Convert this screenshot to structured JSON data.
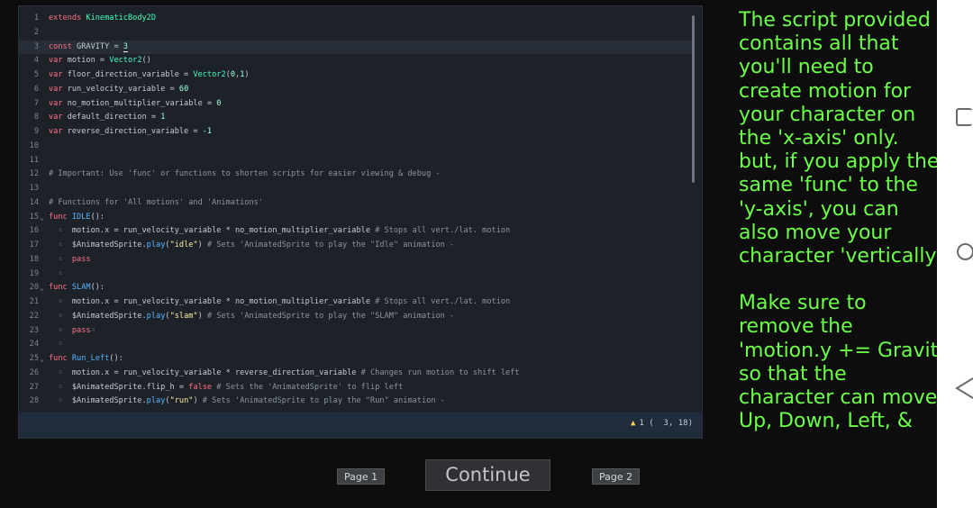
{
  "editor": {
    "cut_top_fragment": "",
    "lines": [
      {
        "num": "1",
        "fold": "",
        "segs": [
          {
            "t": "extends ",
            "c": "kw"
          },
          {
            "t": "KinematicBody2D",
            "c": "ty"
          }
        ]
      },
      {
        "num": "2",
        "fold": "",
        "segs": []
      },
      {
        "num": "3",
        "fold": "",
        "current": true,
        "segs": [
          {
            "t": "const ",
            "c": "kw"
          },
          {
            "t": "GRAVITY = ",
            "c": ""
          },
          {
            "t": "3",
            "c": "num cursor"
          }
        ]
      },
      {
        "num": "4",
        "fold": "",
        "segs": [
          {
            "t": "var ",
            "c": "kw"
          },
          {
            "t": "motion = ",
            "c": ""
          },
          {
            "t": "Vector2",
            "c": "ty"
          },
          {
            "t": "()",
            "c": ""
          }
        ]
      },
      {
        "num": "5",
        "fold": "",
        "segs": [
          {
            "t": "var ",
            "c": "kw"
          },
          {
            "t": "floor_direction_variable = ",
            "c": ""
          },
          {
            "t": "Vector2",
            "c": "ty"
          },
          {
            "t": "(",
            "c": ""
          },
          {
            "t": "0",
            "c": "num"
          },
          {
            "t": ",",
            "c": ""
          },
          {
            "t": "1",
            "c": "num"
          },
          {
            "t": ")",
            "c": ""
          }
        ]
      },
      {
        "num": "6",
        "fold": "",
        "segs": [
          {
            "t": "var ",
            "c": "kw"
          },
          {
            "t": "run_velocity_variable = ",
            "c": ""
          },
          {
            "t": "60",
            "c": "num"
          }
        ]
      },
      {
        "num": "7",
        "fold": "",
        "segs": [
          {
            "t": "var ",
            "c": "kw"
          },
          {
            "t": "no_motion_multiplier_variable = ",
            "c": ""
          },
          {
            "t": "0",
            "c": "num"
          }
        ]
      },
      {
        "num": "8",
        "fold": "",
        "segs": [
          {
            "t": "var ",
            "c": "kw"
          },
          {
            "t": "default_direction = ",
            "c": ""
          },
          {
            "t": "1",
            "c": "num"
          }
        ]
      },
      {
        "num": "9",
        "fold": "",
        "segs": [
          {
            "t": "var ",
            "c": "kw"
          },
          {
            "t": "reverse_direction_variable = ",
            "c": ""
          },
          {
            "t": "-1",
            "c": "num"
          }
        ]
      },
      {
        "num": "10",
        "fold": "",
        "segs": []
      },
      {
        "num": "11",
        "fold": "",
        "segs": []
      },
      {
        "num": "12",
        "fold": "",
        "segs": [
          {
            "t": "# Important: Use 'func' or functions to shorten scripts for easier viewing & debug -",
            "c": "cmt"
          }
        ]
      },
      {
        "num": "13",
        "fold": "",
        "segs": []
      },
      {
        "num": "14",
        "fold": "",
        "segs": [
          {
            "t": "# Functions for 'All motions' and 'Animations'",
            "c": "cmt"
          }
        ]
      },
      {
        "num": "15",
        "fold": "v",
        "segs": [
          {
            "t": "func ",
            "c": "kw"
          },
          {
            "t": "IDLE",
            "c": "fnc"
          },
          {
            "t": "():",
            "c": ""
          }
        ]
      },
      {
        "num": "16",
        "fold": "",
        "segs": [
          {
            "t": "  ¤  ",
            "c": "guide"
          },
          {
            "t": "motion.x = run_velocity_variable * no_motion_multiplier_variable ",
            "c": ""
          },
          {
            "t": "# Stops all vert./lat. motion",
            "c": "cmt"
          }
        ]
      },
      {
        "num": "17",
        "fold": "",
        "segs": [
          {
            "t": "  ¤  ",
            "c": "guide"
          },
          {
            "t": "$AnimatedSprite.",
            "c": ""
          },
          {
            "t": "play",
            "c": "fnc"
          },
          {
            "t": "(",
            "c": ""
          },
          {
            "t": "\"idle\"",
            "c": "str"
          },
          {
            "t": ") ",
            "c": ""
          },
          {
            "t": "# Sets 'AnimatedSprite to play the \"Idle\" animation -",
            "c": "cmt"
          }
        ]
      },
      {
        "num": "18",
        "fold": "",
        "segs": [
          {
            "t": "  ¤  ",
            "c": "guide"
          },
          {
            "t": "pass",
            "c": "kw"
          }
        ]
      },
      {
        "num": "19",
        "fold": "",
        "segs": [
          {
            "t": "  ¤",
            "c": "guide"
          }
        ]
      },
      {
        "num": "20",
        "fold": "v",
        "segs": [
          {
            "t": "func ",
            "c": "kw"
          },
          {
            "t": "SLAM",
            "c": "fnc"
          },
          {
            "t": "():",
            "c": ""
          }
        ]
      },
      {
        "num": "21",
        "fold": "",
        "segs": [
          {
            "t": "  ¤  ",
            "c": "guide"
          },
          {
            "t": "motion.x = run_velocity_variable * no_motion_multiplier_variable ",
            "c": ""
          },
          {
            "t": "# Stops all vert./lat. motion",
            "c": "cmt"
          }
        ]
      },
      {
        "num": "22",
        "fold": "",
        "segs": [
          {
            "t": "  ¤  ",
            "c": "guide"
          },
          {
            "t": "$AnimatedSprite.",
            "c": ""
          },
          {
            "t": "play",
            "c": "fnc"
          },
          {
            "t": "(",
            "c": ""
          },
          {
            "t": "\"slam\"",
            "c": "str"
          },
          {
            "t": ") ",
            "c": ""
          },
          {
            "t": "# Sets 'AnimatedSprite to play the \"SLAM\" animation -",
            "c": "cmt"
          }
        ]
      },
      {
        "num": "23",
        "fold": "",
        "segs": [
          {
            "t": "  ¤  ",
            "c": "guide"
          },
          {
            "t": "pass",
            "c": "kw"
          },
          {
            "t": "¤",
            "c": "guide"
          }
        ]
      },
      {
        "num": "24",
        "fold": "",
        "segs": [
          {
            "t": "  ¤",
            "c": "guide"
          }
        ]
      },
      {
        "num": "25",
        "fold": "v",
        "segs": [
          {
            "t": "func ",
            "c": "kw"
          },
          {
            "t": "Run_Left",
            "c": "fnc"
          },
          {
            "t": "():",
            "c": ""
          }
        ]
      },
      {
        "num": "26",
        "fold": "",
        "segs": [
          {
            "t": "  ¤  ",
            "c": "guide"
          },
          {
            "t": "motion.x = run_velocity_variable * reverse_direction_variable ",
            "c": ""
          },
          {
            "t": "# Changes run motion to shift left",
            "c": "cmt"
          }
        ]
      },
      {
        "num": "27",
        "fold": "",
        "segs": [
          {
            "t": "  ¤  ",
            "c": "guide"
          },
          {
            "t": "$AnimatedSprite.flip_h = ",
            "c": ""
          },
          {
            "t": "false",
            "c": "kw"
          },
          {
            "t": " ",
            "c": ""
          },
          {
            "t": "# Sets the 'AnimatedSprite' to flip left",
            "c": "cmt"
          }
        ]
      },
      {
        "num": "28",
        "fold": "",
        "segs": [
          {
            "t": "  ¤  ",
            "c": "guide"
          },
          {
            "t": "$AnimatedSprite.",
            "c": ""
          },
          {
            "t": "play",
            "c": "fnc"
          },
          {
            "t": "(",
            "c": ""
          },
          {
            "t": "\"run\"",
            "c": "str"
          },
          {
            "t": ") ",
            "c": ""
          },
          {
            "t": "# Sets 'AnimatedSprite to play the \"Run\" animation -",
            "c": "cmt"
          }
        ]
      }
    ],
    "status": {
      "warnings": "1 (",
      "position": "3, 18)"
    }
  },
  "note": {
    "p1": [
      "The script provided",
      "contains all that",
      "you'll need to",
      "create motion for",
      "your character on",
      "the 'x-axis' only.",
      "but, if you apply the",
      "same 'func' to the",
      "'y-axis', you can",
      "also move your",
      "character 'vertically'"
    ],
    "p2": [
      "Make sure to",
      "remove the",
      "'motion.y += Gravity'",
      "so that the",
      "character can move",
      "Up, Down, Left, &"
    ]
  },
  "pager": {
    "prev_label": "Page 1",
    "continue_label": "Continue",
    "next_label": "Page 2"
  },
  "icons": {
    "warning": "warning-icon",
    "recents": "recents-square-icon",
    "home": "home-circle-icon",
    "back": "back-triangle-icon"
  },
  "colors": {
    "editor_bg": "#1d2229",
    "note_text": "#6cff48",
    "keyword": "#ff7085",
    "type": "#42ffc2",
    "string": "#ffeda1",
    "function": "#57b3ff"
  }
}
